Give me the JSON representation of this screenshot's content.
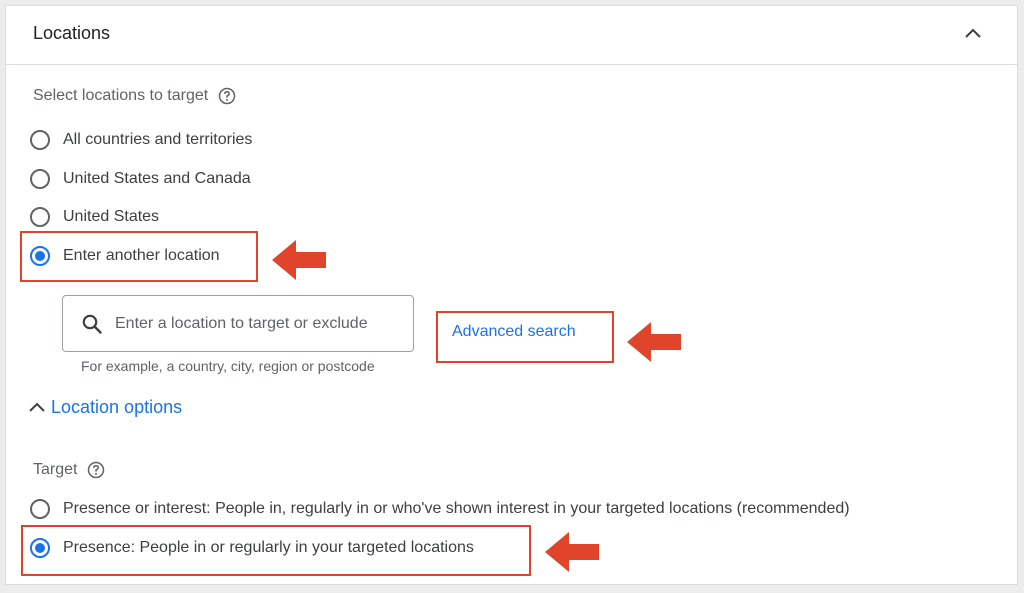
{
  "panel": {
    "title": "Locations"
  },
  "locations": {
    "label": "Select locations to target",
    "options": [
      {
        "label": "All countries and territories",
        "checked": false
      },
      {
        "label": "United States and Canada",
        "checked": false
      },
      {
        "label": "United States",
        "checked": false
      },
      {
        "label": "Enter another location",
        "checked": true
      }
    ]
  },
  "search": {
    "placeholder": "Enter a location to target or exclude",
    "value": "",
    "hint": "For example, a country, city, region or postcode",
    "advanced_label": "Advanced search"
  },
  "location_options": {
    "toggle_label": "Location options",
    "target_label": "Target",
    "options": [
      {
        "label": "Presence or interest: People in, regularly in or who've shown interest in your targeted locations (recommended)",
        "checked": false
      },
      {
        "label": "Presence: People in or regularly in your targeted locations",
        "checked": true
      }
    ]
  },
  "colors": {
    "accent": "#1a73e8",
    "annotation": "#e0452b"
  },
  "icons": [
    "chevron-up-icon",
    "help-icon",
    "search-icon",
    "arrow-left-icon"
  ]
}
